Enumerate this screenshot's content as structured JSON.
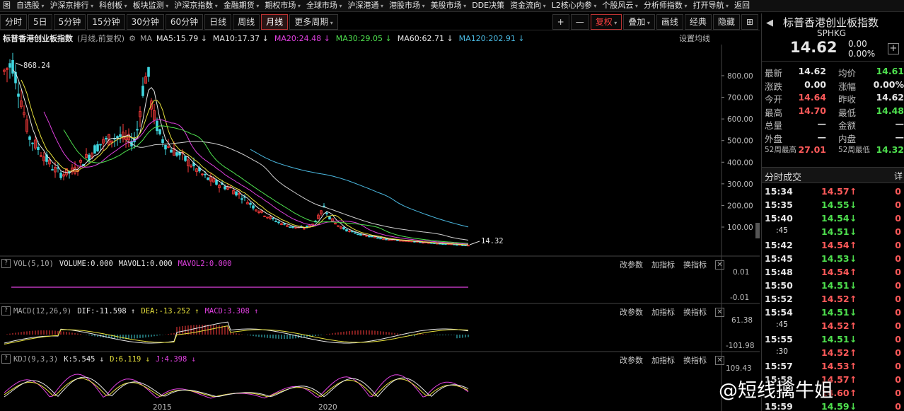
{
  "menu": [
    "图",
    "自选股",
    "沪深京排行",
    "科创板",
    "板块监测",
    "沪深京指数",
    "金融期货",
    "期权市场",
    "全球市场",
    "沪深港通",
    "港股市场",
    "美股市场",
    "DDE决策",
    "资金流向",
    "L2核心内参",
    "个股风云",
    "分析师指数",
    "打开导航",
    "返回"
  ],
  "toolbar": {
    "periods": [
      "分时",
      "5日",
      "5分钟",
      "15分钟",
      "30分钟",
      "60分钟",
      "日线",
      "周线",
      "月线",
      "更多周期"
    ],
    "active_period": "月线",
    "right_buttons": [
      "+",
      "—",
      "复权",
      "叠加",
      "画线",
      "经典",
      "隐藏",
      "⊞"
    ]
  },
  "info": {
    "index_name": "标普香港创业板指数",
    "mode": "(月线,前复权)",
    "ma_label": "MA",
    "ma_items": [
      {
        "text": "MA5:15.79 ↓",
        "color": "#e6e6e6"
      },
      {
        "text": "MA10:17.37 ↓",
        "color": "#e6e6e6"
      },
      {
        "text": "MA20:24.48 ↓",
        "color": "#e040e0"
      },
      {
        "text": "MA30:29.05 ↓",
        "color": "#4ee04e"
      },
      {
        "text": "MA60:62.71 ↓",
        "color": "#e6e6e6"
      },
      {
        "text": "MA120:202.91 ↓",
        "color": "#4ab8e0"
      }
    ],
    "settings": "设置均线"
  },
  "main_chart": {
    "y_ticks": [
      "800.00",
      "700.00",
      "600.00",
      "500.00",
      "400.00",
      "300.00",
      "200.00",
      "100.00"
    ],
    "high_label": "868.24",
    "last_label": "14.32",
    "x_labels": [
      "2015",
      "2020"
    ]
  },
  "vol": {
    "name": "VOL(5,10)",
    "values": [
      {
        "text": "VOLUME:0.000",
        "color": "#e6e6e6"
      },
      {
        "text": "MAVOL1:0.000",
        "color": "#e6e6e6"
      },
      {
        "text": "MAVOL2:0.000",
        "color": "#e040e0"
      }
    ],
    "y_ticks": [
      "0.01",
      "-0.01"
    ]
  },
  "macd": {
    "name": "MACD(12,26,9)",
    "values": [
      {
        "text": "DIF:-11.598 ↑",
        "color": "#e6e6e6"
      },
      {
        "text": "DEA:-13.252 ↑",
        "color": "#e6e03c"
      },
      {
        "text": "MACD:3.308 ↑",
        "color": "#e040e0"
      }
    ],
    "y_ticks": [
      "61.38",
      "-101.98"
    ]
  },
  "kdj": {
    "name": "KDJ(9,3,3)",
    "values": [
      {
        "text": "K:5.545 ↓",
        "color": "#e6e6e6"
      },
      {
        "text": "D:6.119 ↓",
        "color": "#e6e03c"
      },
      {
        "text": "J:4.398 ↓",
        "color": "#e040e0"
      }
    ],
    "y_ticks": [
      "109.43"
    ]
  },
  "pane_tools": [
    "改参数",
    "加指标",
    "换指标"
  ],
  "quote": {
    "name": "标普香港创业板指数",
    "code": "SPHKG",
    "price": "14.62",
    "change": "0.00",
    "change_pct": "0.00%",
    "rows": [
      {
        "l1": "最新",
        "v1": "14.62",
        "c1": "#e6e6e6",
        "l2": "均价",
        "v2": "14.61",
        "c2": "#4ee04e"
      },
      {
        "l1": "涨跌",
        "v1": "0.00",
        "c1": "#e6e6e6",
        "l2": "涨幅",
        "v2": "0.00%",
        "c2": "#e6e6e6"
      },
      {
        "l1": "今开",
        "v1": "14.64",
        "c1": "#ff5a5a",
        "l2": "昨收",
        "v2": "14.62",
        "c2": "#e6e6e6"
      },
      {
        "l1": "最高",
        "v1": "14.70",
        "c1": "#ff5a5a",
        "l2": "最低",
        "v2": "14.48",
        "c2": "#4ee04e"
      },
      {
        "l1": "总量",
        "v1": "—",
        "c1": "#e6e6e6",
        "l2": "金额",
        "v2": "—",
        "c2": "#e6e6e6"
      },
      {
        "l1": "外盘",
        "v1": "—",
        "c1": "#e6e6e6",
        "l2": "内盘",
        "v2": "—",
        "c2": "#e6e6e6"
      },
      {
        "l1": "52周最高",
        "v1": "27.01",
        "c1": "#ff5a5a",
        "l2": "52周最低",
        "v2": "14.32",
        "c2": "#4ee04e"
      }
    ]
  },
  "ticks_panel": {
    "title": "分时成交",
    "detail": "详",
    "rows": [
      {
        "time": "15:34",
        "price": "14.57",
        "dir": "up",
        "vol": "0"
      },
      {
        "time": "15:35",
        "price": "14.55",
        "dir": "down",
        "vol": "0"
      },
      {
        "time": "15:40",
        "price": "14.54",
        "dir": "down",
        "vol": "0"
      },
      {
        "time": ":45",
        "price": "14.51",
        "dir": "down",
        "vol": "0"
      },
      {
        "time": "15:42",
        "price": "14.54",
        "dir": "up",
        "vol": "0"
      },
      {
        "time": "15:45",
        "price": "14.53",
        "dir": "down",
        "vol": "0"
      },
      {
        "time": "15:48",
        "price": "14.54",
        "dir": "up",
        "vol": "0"
      },
      {
        "time": "15:50",
        "price": "14.51",
        "dir": "down",
        "vol": "0"
      },
      {
        "time": "15:52",
        "price": "14.52",
        "dir": "up",
        "vol": "0"
      },
      {
        "time": "15:54",
        "price": "14.51",
        "dir": "down",
        "vol": "0"
      },
      {
        "time": ":45",
        "price": "14.52",
        "dir": "up",
        "vol": "0"
      },
      {
        "time": "15:55",
        "price": "14.51",
        "dir": "down",
        "vol": "0"
      },
      {
        "time": ":30",
        "price": "14.52",
        "dir": "up",
        "vol": "0"
      },
      {
        "time": "15:57",
        "price": "14.53",
        "dir": "up",
        "vol": "0"
      },
      {
        "time": "15:58",
        "price": "14.57",
        "dir": "up",
        "vol": "0"
      },
      {
        "time": ":45",
        "price": "14.60",
        "dir": "up",
        "vol": "0"
      },
      {
        "time": "15:59",
        "price": "14.59",
        "dir": "down",
        "vol": "0"
      }
    ]
  },
  "watermark": "@短线擒牛姐"
}
